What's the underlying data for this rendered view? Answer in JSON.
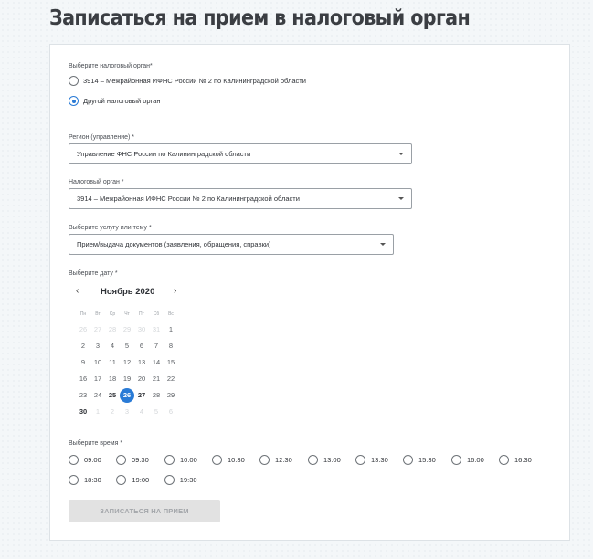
{
  "page": {
    "title": "Записаться на прием в налоговый орган"
  },
  "office_choice": {
    "label": "Выберите налоговый орган*",
    "options": [
      {
        "label": "3914 – Межрайонная ИФНС России № 2 по Калининградской области",
        "checked": false
      },
      {
        "label": "Другой налоговый орган",
        "checked": true
      }
    ]
  },
  "region": {
    "label": "Регион (управление) *",
    "value": "Управление ФНС России по Калининградской области"
  },
  "tax_office": {
    "label": "Налоговый орган *",
    "value": "3914 – Межрайонная ИФНС России № 2 по Калининградской области"
  },
  "service": {
    "label": "Выберите услугу или тему *",
    "value": "Прием/выдача документов (заявления, обращения, справки)"
  },
  "date": {
    "label": "Выберите дату *",
    "prev_icon": "‹",
    "next_icon": "›",
    "month": "Ноябрь 2020",
    "weekdays": [
      "Пн",
      "Вт",
      "Ср",
      "Чт",
      "Пт",
      "Сб",
      "Вс"
    ],
    "weeks": [
      [
        {
          "d": "26",
          "s": "muted"
        },
        {
          "d": "27",
          "s": "muted"
        },
        {
          "d": "28",
          "s": "muted"
        },
        {
          "d": "29",
          "s": "muted"
        },
        {
          "d": "30",
          "s": "muted"
        },
        {
          "d": "31",
          "s": "muted"
        },
        {
          "d": "1",
          "s": "normal"
        }
      ],
      [
        {
          "d": "2",
          "s": "normal"
        },
        {
          "d": "3",
          "s": "normal"
        },
        {
          "d": "4",
          "s": "normal"
        },
        {
          "d": "5",
          "s": "normal"
        },
        {
          "d": "6",
          "s": "normal"
        },
        {
          "d": "7",
          "s": "normal"
        },
        {
          "d": "8",
          "s": "normal"
        }
      ],
      [
        {
          "d": "9",
          "s": "normal"
        },
        {
          "d": "10",
          "s": "normal"
        },
        {
          "d": "11",
          "s": "normal"
        },
        {
          "d": "12",
          "s": "normal"
        },
        {
          "d": "13",
          "s": "normal"
        },
        {
          "d": "14",
          "s": "normal"
        },
        {
          "d": "15",
          "s": "normal"
        }
      ],
      [
        {
          "d": "16",
          "s": "normal"
        },
        {
          "d": "17",
          "s": "normal"
        },
        {
          "d": "18",
          "s": "normal"
        },
        {
          "d": "19",
          "s": "normal"
        },
        {
          "d": "20",
          "s": "normal"
        },
        {
          "d": "21",
          "s": "normal"
        },
        {
          "d": "22",
          "s": "normal"
        }
      ],
      [
        {
          "d": "23",
          "s": "normal"
        },
        {
          "d": "24",
          "s": "normal"
        },
        {
          "d": "25",
          "s": "bold"
        },
        {
          "d": "26",
          "s": "selected"
        },
        {
          "d": "27",
          "s": "bold"
        },
        {
          "d": "28",
          "s": "normal"
        },
        {
          "d": "29",
          "s": "normal"
        }
      ],
      [
        {
          "d": "30",
          "s": "bold"
        },
        {
          "d": "1",
          "s": "muted"
        },
        {
          "d": "2",
          "s": "muted"
        },
        {
          "d": "3",
          "s": "muted"
        },
        {
          "d": "4",
          "s": "muted"
        },
        {
          "d": "5",
          "s": "muted"
        },
        {
          "d": "6",
          "s": "muted"
        }
      ]
    ]
  },
  "time": {
    "label": "Выберите время *",
    "slots": [
      "09:00",
      "09:30",
      "10:00",
      "10:30",
      "12:30",
      "13:00",
      "13:30",
      "15:30",
      "16:00",
      "16:30",
      "18:30",
      "19:00",
      "19:30"
    ]
  },
  "submit": {
    "label": "ЗАПИСАТЬСЯ НА ПРИЕМ"
  },
  "colors": {
    "accent": "#2a7bd6",
    "disabled_button": "#e2e2e2",
    "title": "#3b3e43"
  }
}
